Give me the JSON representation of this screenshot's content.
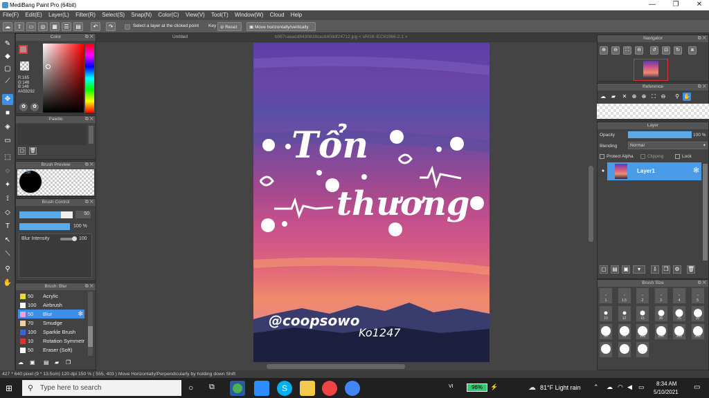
{
  "window": {
    "title": "MediBang Paint Pro (64bit)",
    "minimize": "—",
    "maximize": "❐",
    "close": "✕"
  },
  "menu": [
    "File(F)",
    "Edit(E)",
    "Layer(L)",
    "Filter(R)",
    "Select(S)",
    "Snap(N)",
    "Color(C)",
    "View(V)",
    "Tool(T)",
    "Window(W)",
    "Cloud",
    "Help"
  ],
  "toolbar": {
    "select_layer_label": "Select a layer at the clicked point",
    "key_label": "Key",
    "reset_label": "Reset",
    "move_label": "Move horizontally/vertically"
  },
  "canvas": {
    "tab_untitled": "Untitled",
    "tab_file": "b067caeacd8430818cac840ddf24712.jpg < sRGB IEC61966-2.1 >",
    "artwork_text": {
      "line1": "Tổn",
      "line2": "thương",
      "signature": "@coopsowo",
      "date": "Ko1247"
    }
  },
  "color_panel": {
    "title": "Color",
    "r": "R:165",
    "g": "G:146",
    "b": "B:146",
    "hex": "#A59292",
    "main_color": "#a59292"
  },
  "palette_panel": {
    "title": "Palette"
  },
  "brush_preview": {
    "title": "Brush Preview",
    "size": "10.58"
  },
  "brush_control": {
    "title": "Brush Control",
    "size_value": "50",
    "opacity_value": "100 %",
    "blur_label": "Blur Intensity",
    "blur_value": "100"
  },
  "brush_list": {
    "title": "Brush: Blur",
    "items": [
      {
        "size": "50",
        "name": "Acrylic",
        "color": "#e8d838"
      },
      {
        "size": "100",
        "name": "Airbrush",
        "color": "#ffffff"
      },
      {
        "size": "50",
        "name": "Blur",
        "color": "#e8a0d8",
        "selected": true
      },
      {
        "size": "70",
        "name": "Smudge",
        "color": "#f0d0a0"
      },
      {
        "size": "100",
        "name": "Sparkle Brush",
        "color": "#4060e0"
      },
      {
        "size": "10",
        "name": "Rotation Symmetry",
        "color": "#e03030"
      },
      {
        "size": "50",
        "name": "Eraser (Soft)",
        "color": "#ffffff"
      }
    ]
  },
  "navigator": {
    "title": "Navigator"
  },
  "reference": {
    "title": "Reference"
  },
  "layer_panel": {
    "title": "Layer",
    "opacity_label": "Opacity",
    "opacity_value": "100 %",
    "opacity_fraction": 1.0,
    "blending_label": "Blending",
    "blending_value": "Normal",
    "protect_alpha": "Protect Alpha",
    "clipping": "Clipping",
    "lock": "Lock",
    "layer_name": "Layer1"
  },
  "brush_size": {
    "title": "Brush Size",
    "rows": [
      [
        "1",
        "1.5",
        "2",
        "3",
        "4",
        "5"
      ],
      [
        "10",
        "12",
        "15",
        "20",
        "25",
        "30"
      ],
      [
        "50",
        "70",
        "100",
        "150",
        "200",
        "300"
      ],
      [
        "",
        "",
        ""
      ]
    ]
  },
  "status": {
    "size": "427 * 640 pixel",
    "cm": "(9 * 13.5cm)",
    "dpi": "120 dpi",
    "zoom": "150 %",
    "coords": "( 555, 403 )",
    "hint": "Move Horizontally/Perpendicularly by holding down Shift"
  },
  "taskbar": {
    "search_placeholder": "Type here to search",
    "battery": "96%",
    "weather": "81°F  Light rain",
    "time": "8:34 AM",
    "date": "5/10/2021",
    "vi_label": "VI"
  }
}
